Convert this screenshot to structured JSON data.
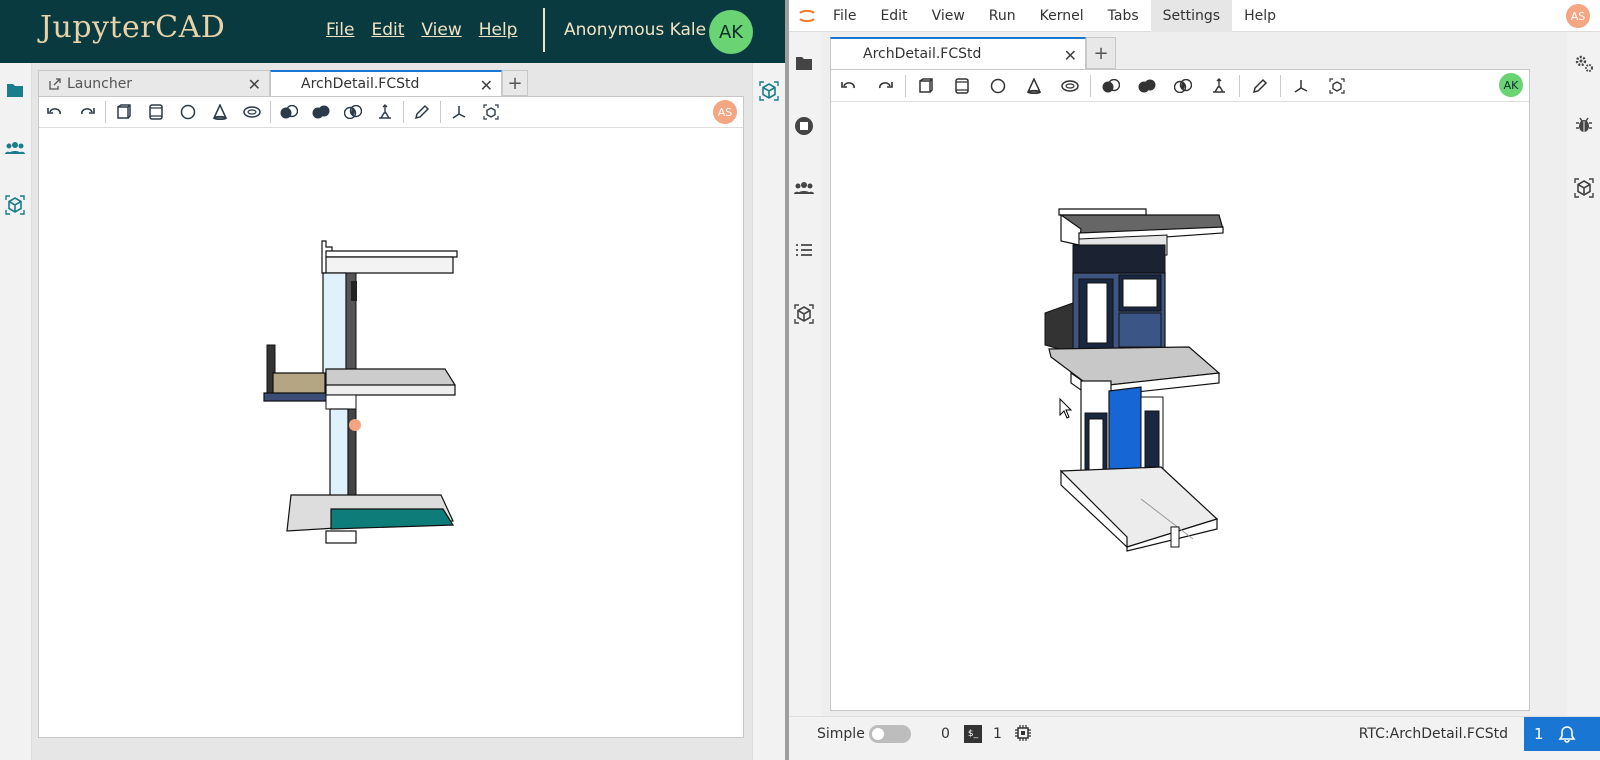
{
  "left": {
    "app_title": "JupyterCAD",
    "menu": [
      "File",
      "Edit",
      "View",
      "Help"
    ],
    "user_name": "Anonymous Kale",
    "user_initials": "AK",
    "tabs": [
      {
        "label": "Launcher",
        "active": false
      },
      {
        "label": "ArchDetail.FCStd",
        "active": true
      }
    ],
    "collaborator_initials": "AS"
  },
  "right": {
    "menu": [
      "File",
      "Edit",
      "View",
      "Run",
      "Kernel",
      "Tabs",
      "Settings",
      "Help"
    ],
    "highlighted_menu": "Settings",
    "user_initials": "AS",
    "tabs": [
      {
        "label": "ArchDetail.FCStd",
        "active": true
      }
    ],
    "collaborator_initials": "AK",
    "status": {
      "mode_label": "Simple",
      "kernels": "0",
      "terminals": "1",
      "rtc_label": "RTC:ArchDetail.FCStd",
      "notifications": "1"
    }
  },
  "colors": {
    "header_bg": "#093a40",
    "header_text": "#f2e4c3",
    "accent": "#1976d2",
    "avatar_ak": "#6ad374",
    "avatar_as": "#f4a582"
  }
}
